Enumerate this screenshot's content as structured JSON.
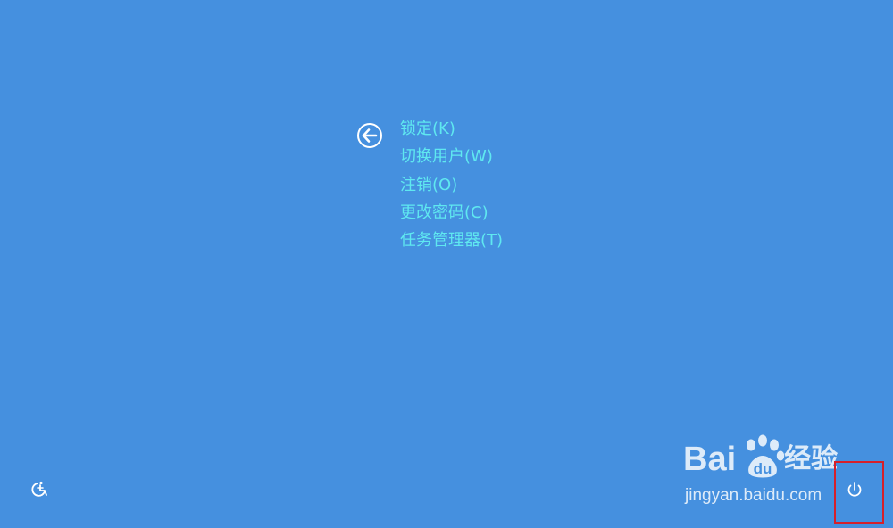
{
  "colors": {
    "background": "#4590df",
    "menu_text": "#5fe8f0",
    "icon": "#ffffff",
    "highlight": "#d6202a",
    "watermark": "#ffffff"
  },
  "back_button": {
    "icon": "back-arrow-icon"
  },
  "menu": {
    "items": [
      {
        "label": "锁定(K)"
      },
      {
        "label": "切换用户(W)"
      },
      {
        "label": "注销(O)"
      },
      {
        "label": "更改密码(C)"
      },
      {
        "label": "任务管理器(T)"
      }
    ]
  },
  "ease_of_access": {
    "icon": "ease-of-access-icon"
  },
  "power": {
    "icon": "power-icon"
  },
  "watermark": {
    "logo_left": "Bai",
    "logo_right": "u",
    "logo_suffix": "经验",
    "url": "jingyan.baidu.com"
  }
}
